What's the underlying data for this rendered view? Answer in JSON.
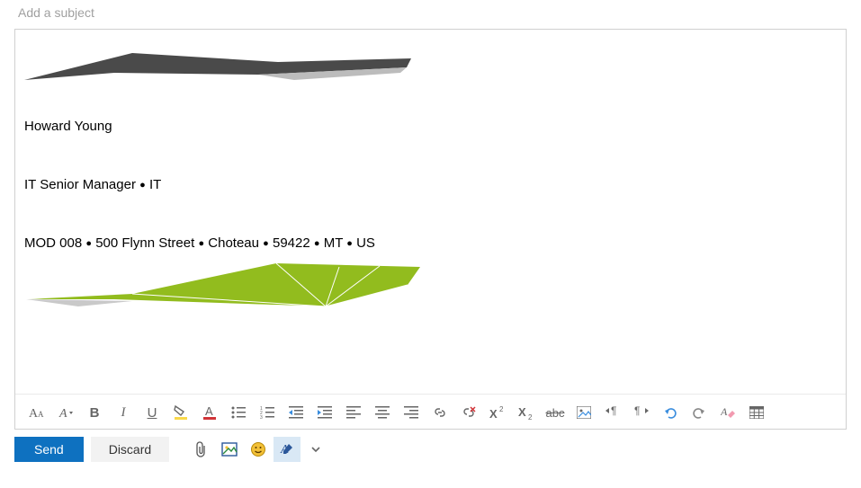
{
  "subject": {
    "placeholder": "Add a subject",
    "value": ""
  },
  "signature": {
    "name": "Howard Young",
    "role": "IT Senior Manager",
    "dept": "IT",
    "addr": {
      "org": "MOD 008",
      "street": "500 Flynn Street",
      "city": "Choteau",
      "zip": "59422",
      "state": "MT",
      "country": "US"
    }
  },
  "bullet": "●",
  "toolbar": {
    "font_size": "Font size",
    "font_face": "Font",
    "bold": "B",
    "italic": "I",
    "underline": "U",
    "highlight": "Highlight",
    "font_color": "Font color",
    "bullets": "Bullets",
    "numbering": "Numbering",
    "outdent": "Decrease indent",
    "indent": "Increase indent",
    "align_left": "Align left",
    "align_center": "Align center",
    "align_right": "Align right",
    "link": "Insert link",
    "unlink": "Remove link",
    "superscript": "Superscript",
    "subscript": "Subscript",
    "strike": "Strikethrough",
    "insert_image": "Insert image",
    "ltr": "Left to right",
    "rtl": "Right to left",
    "undo": "Undo",
    "redo": "Redo",
    "clear": "Clear formatting",
    "table": "Insert table"
  },
  "actions": {
    "send": "Send",
    "discard": "Discard",
    "attach": "Attach",
    "picture": "Insert picture",
    "emoji": "Emoji",
    "signature": "Signature",
    "more": "More"
  },
  "colors": {
    "primary": "#0E71C0",
    "green": "#92BC1E",
    "gray_dark": "#4a4a4a",
    "gray_light": "#bcbcbc",
    "highlight_yellow": "#f9d84a",
    "font_red": "#d13438",
    "emoji_yellow": "#f2c037",
    "undo_blue": "#3a8dde",
    "eraser_pink": "#f29ab0"
  }
}
